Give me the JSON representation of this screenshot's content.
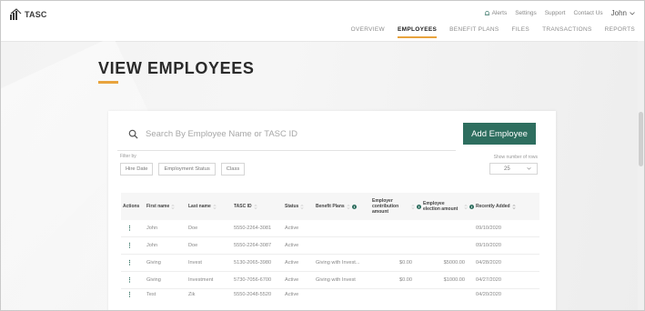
{
  "brand": {
    "logo_text": "TASC"
  },
  "utility_nav": {
    "alerts": "Alerts",
    "settings": "Settings",
    "support": "Support",
    "contact": "Contact Us",
    "user": "John"
  },
  "main_nav": [
    {
      "label": "OVERVIEW",
      "active": false
    },
    {
      "label": "EMPLOYEES",
      "active": true
    },
    {
      "label": "BENEFIT PLANS",
      "active": false
    },
    {
      "label": "FILES",
      "active": false
    },
    {
      "label": "TRANSACTIONS",
      "active": false
    },
    {
      "label": "REPORTS",
      "active": false
    }
  ],
  "page": {
    "title": "VIEW EMPLOYEES"
  },
  "search": {
    "placeholder": "Search By Employee Name or TASC ID"
  },
  "actions": {
    "add_employee": "Add Employee"
  },
  "filters": {
    "label": "Filter by",
    "chips": [
      "Hire Date",
      "Employment Status",
      "Class"
    ]
  },
  "rows_per_page": {
    "label": "Show number of rows",
    "value": "25"
  },
  "table": {
    "headers": {
      "actions": "Actions",
      "first_name": "First name",
      "last_name": "Last name",
      "tasc_id": "TASC ID",
      "status": "Status",
      "benefit_plans": "Benefit Plans",
      "employer_contribution": "Employer contribution amount",
      "employee_election": "Employee election amount",
      "recently_added": "Recently Added"
    },
    "rows": [
      {
        "first": "John",
        "last": "Doe",
        "id": "5550-2264-3081",
        "status": "Active",
        "plans": "",
        "employer": "",
        "election": "",
        "added": "09/10/2020"
      },
      {
        "first": "John",
        "last": "Doe",
        "id": "5550-2264-3087",
        "status": "Active",
        "plans": "",
        "employer": "",
        "election": "",
        "added": "09/10/2020"
      },
      {
        "first": "Giving",
        "last": "Invest",
        "id": "5130-2065-3980",
        "status": "Active",
        "plans": "Giving with Invest...",
        "employer": "$0.00",
        "election": "$5000.00",
        "added": "04/28/2020"
      },
      {
        "first": "Giving",
        "last": "Investment",
        "id": "5730-7056-6700",
        "status": "Active",
        "plans": "Giving with Invest",
        "employer": "$0.00",
        "election": "$1000.00",
        "added": "04/27/2020"
      },
      {
        "first": "Test",
        "last": "Zik",
        "id": "5550-2048-5520",
        "status": "Active",
        "plans": "",
        "employer": "",
        "election": "",
        "added": "04/20/2020"
      }
    ]
  },
  "colors": {
    "accent": "#e8a33d",
    "primary": "#2e6e5f"
  },
  "icons": [
    "tasc-logo-icon",
    "bell-icon",
    "chevron-down-icon",
    "search-icon",
    "sort-icon",
    "info-icon",
    "more-vertical-icon"
  ]
}
